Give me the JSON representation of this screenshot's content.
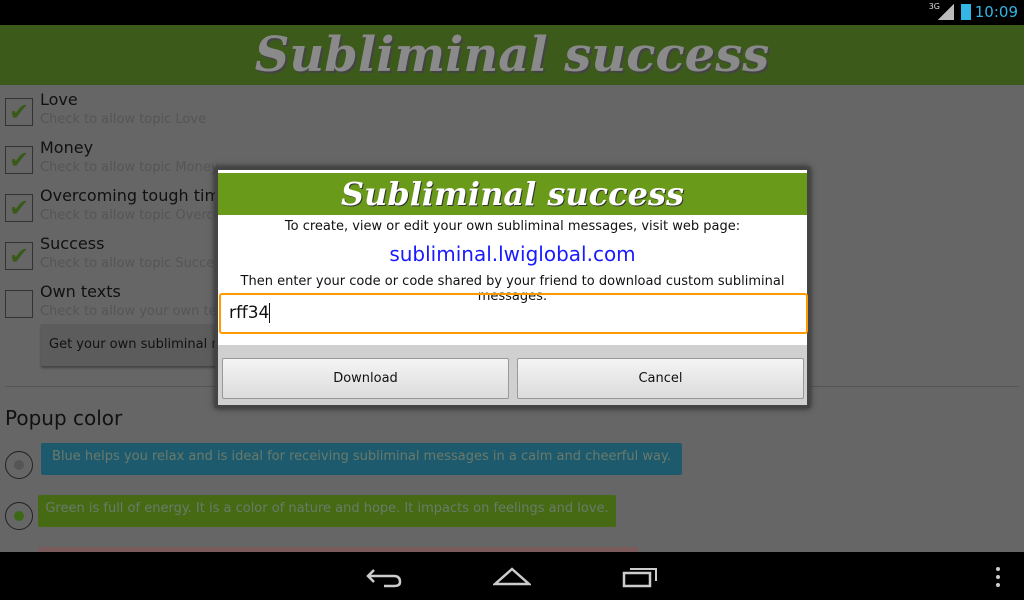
{
  "status": {
    "network": "3G",
    "time": "10:09",
    "accent": "#33b5e5"
  },
  "header": {
    "title": "Subliminal success"
  },
  "topics": [
    {
      "title": "Love",
      "summary": "Check to allow topic Love",
      "checked": true
    },
    {
      "title": "Money",
      "summary": "Check to allow topic Money",
      "checked": true
    },
    {
      "title": "Overcoming tough times",
      "summary": "Check to allow topic Overcoming tough times",
      "checked": true
    },
    {
      "title": "Success",
      "summary": "Check to allow topic Success",
      "checked": true
    },
    {
      "title": "Own texts",
      "summary": "Check to allow your own texts",
      "checked": false
    }
  ],
  "get_own_button": "Get your own subliminal messages",
  "popup_color": {
    "heading": "Popup color",
    "options": [
      {
        "text": "Blue helps you relax and is ideal for receiving subliminal messages in a calm and cheerful way.",
        "color": "#1e5a6e",
        "selected": false
      },
      {
        "text": "Green is full of energy. It is a color of nature and hope. It impacts on feelings and love.",
        "color": "#466a14",
        "selected": true
      }
    ]
  },
  "dialog": {
    "title": "Subliminal success",
    "line1": "To create, view or edit your own subliminal messages, visit web page:",
    "link": "subliminal.lwiglobal.com",
    "line2": "Then enter your code or code shared by your friend to download custom subliminal messages:",
    "code_value": "rff34",
    "download": "Download",
    "cancel": "Cancel"
  },
  "navbar": {
    "icons": [
      "back-icon",
      "home-icon",
      "recent-apps-icon",
      "overflow-menu-icon"
    ]
  }
}
